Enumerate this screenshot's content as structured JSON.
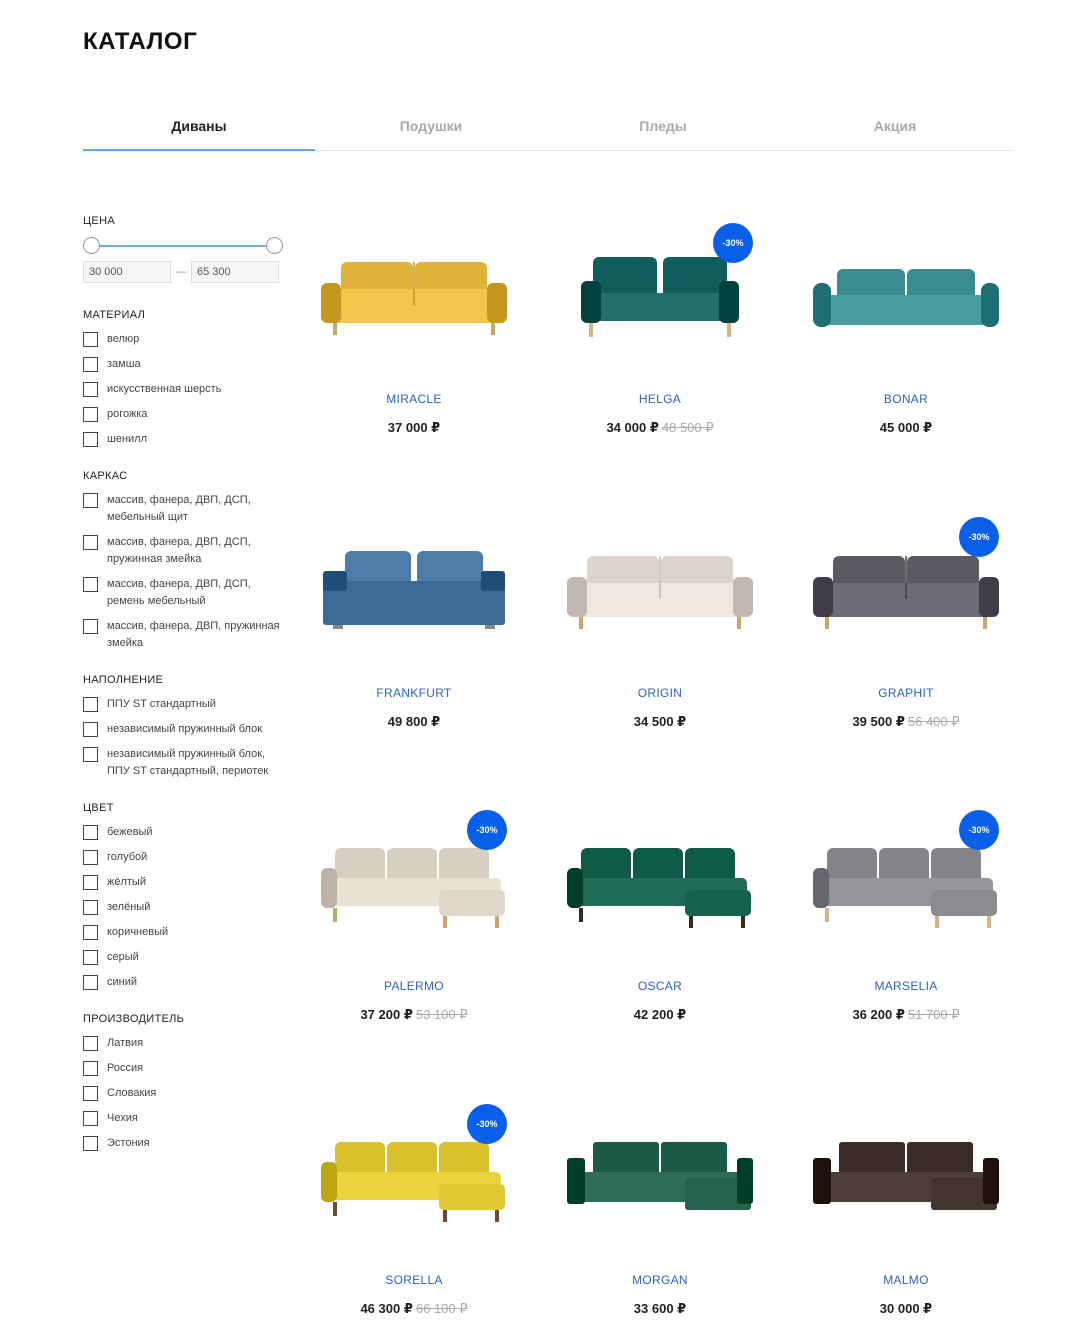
{
  "title": "КАТАЛОГ",
  "tabs": [
    "Диваны",
    "Подушки",
    "Пледы",
    "Акция"
  ],
  "filters": {
    "price": {
      "label": "ЦЕНА",
      "min": "30 000",
      "max": "65 300"
    },
    "material": {
      "label": "МАТЕРИАЛ",
      "options": [
        "велюр",
        "замша",
        "искусственная шерсть",
        "рогожка",
        "шенилл"
      ]
    },
    "frame": {
      "label": "КАРКАС",
      "options": [
        "массив, фанера, ДВП, ДСП, мебельный щит",
        "массив, фанера, ДВП, ДСП, пружинная змейка",
        "массив, фанера, ДВП, ДСП, ремень мебельный",
        "массив, фанера, ДВП, пружинная змейка"
      ]
    },
    "filling": {
      "label": "НАПОЛНЕНИЕ",
      "options": [
        "ППУ ST стандартный",
        "независимый пружинный блок",
        "независимый пружинный блок, ППУ ST стандартный, периотек"
      ]
    },
    "color": {
      "label": "ЦВЕТ",
      "options": [
        "бежевый",
        "голубой",
        "жёлтый",
        "зелёный",
        "коричневый",
        "серый",
        "синий"
      ]
    },
    "maker": {
      "label": "ПРОИЗВОДИТЕЛЬ",
      "options": [
        "Латвия",
        "Россия",
        "Словакия",
        "Чехия",
        "Эстония"
      ]
    }
  },
  "products": [
    {
      "name": "MIRACLE",
      "price": "37 000 ₽",
      "old": "",
      "badge": "",
      "color": "#e0b33a",
      "shape": "sofa",
      "legs": "#c9a56a"
    },
    {
      "name": "HELGA",
      "price": "34 000 ₽",
      "old": "48 500 ₽",
      "badge": "-30%",
      "color": "#0f5e5b",
      "shape": "compact",
      "legs": "#d4b485"
    },
    {
      "name": "BONAR",
      "price": "45 000 ₽",
      "old": "",
      "badge": "",
      "color": "#3a8a91",
      "shape": "modern",
      "legs": "#2e6e73"
    },
    {
      "name": "FRANKFURT",
      "price": "49 800 ₽",
      "old": "",
      "badge": "",
      "color": "#3c6a97",
      "shape": "euro",
      "legs": "#888888"
    },
    {
      "name": "ORIGIN",
      "price": "34 500 ₽",
      "old": "",
      "badge": "",
      "color": "#ddd5cb",
      "shape": "sofa",
      "legs": "#c9a56a"
    },
    {
      "name": "GRAPHIT",
      "price": "39 500 ₽",
      "old": "56 400 ₽",
      "badge": "-30%",
      "color": "#5b5961",
      "shape": "sofa",
      "legs": "#c9a56a"
    },
    {
      "name": "PALERMO",
      "price": "37 200 ₽",
      "old": "53 100 ₽",
      "badge": "-30%",
      "color": "#d8cfc3",
      "shape": "corner",
      "legs": "#c9a56a"
    },
    {
      "name": "OSCAR",
      "price": "42 200 ₽",
      "old": "",
      "badge": "",
      "color": "#0f5a45",
      "shape": "corner",
      "legs": "#3a2a1e"
    },
    {
      "name": "MARSELIA",
      "price": "36 200 ₽",
      "old": "51 700 ₽",
      "badge": "-30%",
      "color": "#838389",
      "shape": "corner",
      "legs": "#d4b485"
    },
    {
      "name": "SORELLA",
      "price": "46 300 ₽",
      "old": "66 100 ₽",
      "badge": "-30%",
      "color": "#d8c12a",
      "shape": "corner",
      "legs": "#6b4a2f"
    },
    {
      "name": "MORGAN",
      "price": "33 600 ₽",
      "old": "",
      "badge": "",
      "color": "#1d5a43",
      "shape": "modcorner",
      "legs": "#1d5a43"
    },
    {
      "name": "MALMO",
      "price": "30 000 ₽",
      "old": "",
      "badge": "",
      "color": "#3b2d26",
      "shape": "modcorner",
      "legs": "#2a201b"
    }
  ]
}
